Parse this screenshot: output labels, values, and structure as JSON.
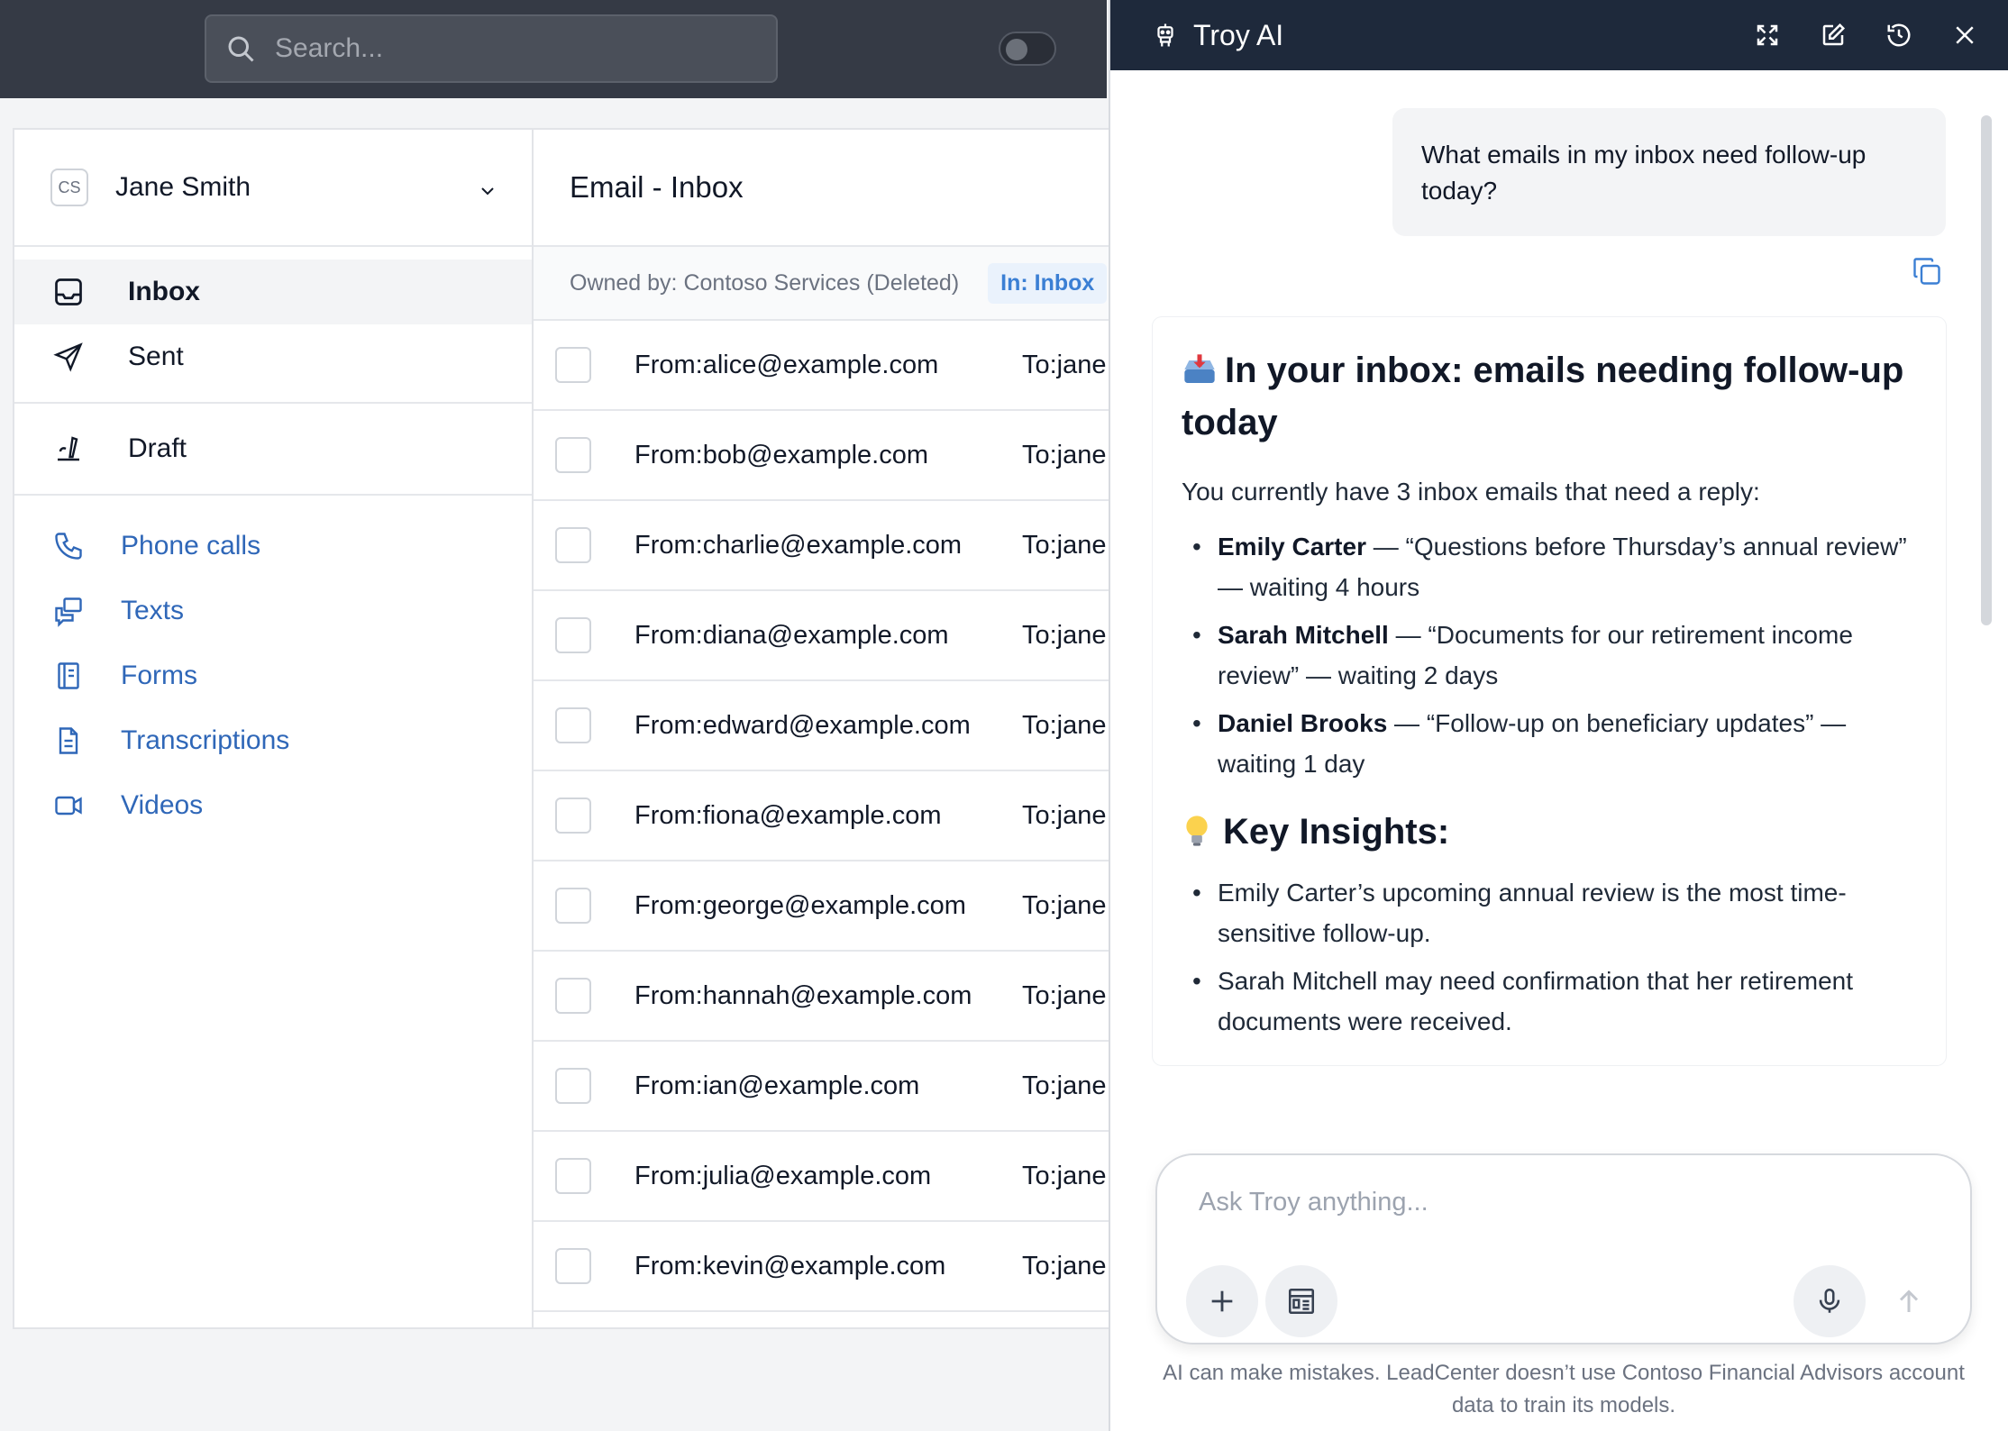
{
  "search": {
    "placeholder": "Search..."
  },
  "account": {
    "initials": "CS",
    "name": "Jane Smith"
  },
  "nav": {
    "primary": [
      {
        "label": "Inbox",
        "icon": "inbox-icon",
        "active": true
      },
      {
        "label": "Sent",
        "icon": "send-icon",
        "active": false
      }
    ],
    "secondary": [
      {
        "label": "Draft",
        "icon": "draft-icon"
      }
    ],
    "links": [
      {
        "label": "Phone calls",
        "icon": "phone-icon"
      },
      {
        "label": "Texts",
        "icon": "chat-icon"
      },
      {
        "label": "Forms",
        "icon": "form-icon"
      },
      {
        "label": "Transcriptions",
        "icon": "document-icon"
      },
      {
        "label": "Videos",
        "icon": "video-icon"
      }
    ]
  },
  "email": {
    "title": "Email - Inbox",
    "owned_by": "Owned by: Contoso Services (Deleted)",
    "in_badge": "In: Inbox",
    "rows": [
      {
        "from": "From:alice@example.com",
        "to": "To:jane"
      },
      {
        "from": "From:bob@example.com",
        "to": "To:jane"
      },
      {
        "from": "From:charlie@example.com",
        "to": "To:jane"
      },
      {
        "from": "From:diana@example.com",
        "to": "To:jane"
      },
      {
        "from": "From:edward@example.com",
        "to": "To:jane"
      },
      {
        "from": "From:fiona@example.com",
        "to": "To:jane"
      },
      {
        "from": "From:george@example.com",
        "to": "To:jane"
      },
      {
        "from": "From:hannah@example.com",
        "to": "To:jane"
      },
      {
        "from": "From:ian@example.com",
        "to": "To:jane"
      },
      {
        "from": "From:julia@example.com",
        "to": "To:jane"
      },
      {
        "from": "From:kevin@example.com",
        "to": "To:jane"
      }
    ]
  },
  "troy": {
    "title": "Troy AI",
    "user_message": "What emails in my inbox need follow-up today?",
    "heading": "In your inbox: emails needing follow-up today",
    "intro": "You currently have 3 inbox emails that need a reply:",
    "followups": [
      {
        "name": "Emily Carter",
        "text": " — “Questions before Thursday’s annual review” — waiting 4 hours"
      },
      {
        "name": "Sarah Mitchell",
        "text": " — “Documents for our retirement income review” — waiting 2 days"
      },
      {
        "name": "Daniel Brooks",
        "text": " — “Follow-up on beneficiary updates” — waiting 1 day"
      }
    ],
    "insights_heading": "Key Insights:",
    "insights": [
      "Emily Carter’s upcoming annual review is the most time-sensitive follow-up.",
      "Sarah Mitchell may need confirmation that her retirement documents were received."
    ],
    "composer_placeholder": "Ask Troy anything...",
    "disclaimer": "AI can make mistakes. LeadCenter doesn’t use Contoso Financial Advisors account data to train its models."
  },
  "colors": {
    "accent": "#2f67b8",
    "header": "#1e293b",
    "topbar": "#353a45",
    "badge": "#3b7fd4"
  }
}
